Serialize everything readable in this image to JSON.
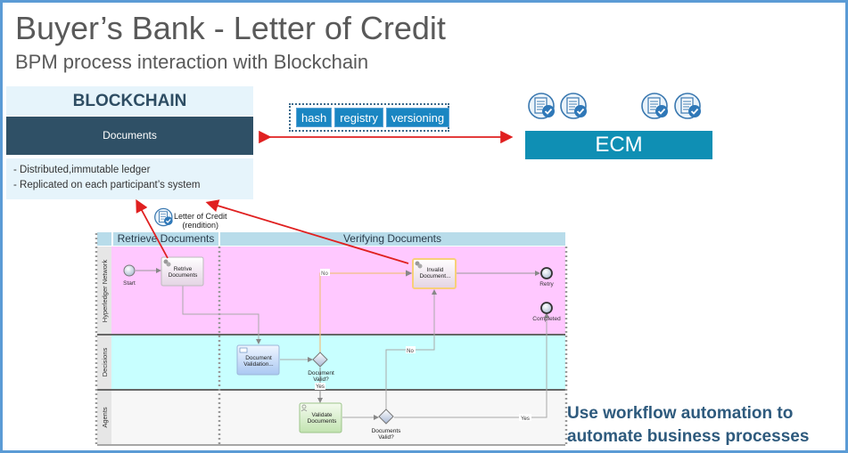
{
  "header": {
    "title": "Buyer’s Bank - Letter of Credit",
    "subtitle": "BPM process interaction with Blockchain"
  },
  "blockchain": {
    "heading": "BLOCKCHAIN",
    "documents_label": "Documents",
    "notes": [
      "- Distributed,immutable ledger",
      "- Replicated on each participant’s system"
    ]
  },
  "services": {
    "tags": [
      "hash",
      "registry",
      "versioning"
    ]
  },
  "ecm": {
    "label": "ECM",
    "document_icons": [
      "document-check-icon",
      "document-check-icon",
      "document-check-icon",
      "document-check-icon"
    ]
  },
  "letter_of_credit": {
    "label_line1": "Letter of Credit",
    "label_line2": "(rendition)",
    "icon": "document-check-icon"
  },
  "process": {
    "phases": [
      "Retrieve Documents",
      "Verifying Documents"
    ],
    "lanes": [
      "Hyperledger Network",
      "Decisions",
      "Agents"
    ],
    "events": {
      "start": "Start",
      "retry": "Retry",
      "completed": "Completed"
    },
    "tasks": {
      "retrieve": [
        "Retrive",
        "Documents"
      ],
      "invalid": [
        "Invalid",
        "Document..."
      ],
      "validation": [
        "Document",
        "Validation..."
      ],
      "validate": [
        "Validate",
        "Documents"
      ]
    },
    "gateways": {
      "document_valid": [
        "Document",
        "Valid?"
      ],
      "documents_valid": [
        "Documents",
        "Valid?"
      ]
    },
    "flow_labels": {
      "no_top": "No",
      "yes_decision": "Yes",
      "no_agents": "No",
      "yes_agents": "Yes"
    }
  },
  "colors": {
    "frame": "#5b9bd5",
    "blockchain_dark": "#2f5066",
    "blockchain_light": "#e6f4fb",
    "tag_blue": "#1a86c2",
    "ecm_teal": "#0f8fb4",
    "arrow_red": "#e02020",
    "lane_network": "#ffc8ff",
    "lane_decisions": "#c8ffff",
    "lane_agents": "#f7f7f7",
    "phase_header": "#b8dcea",
    "callout": "#2e5a7d"
  },
  "callout": {
    "line1": "Use workflow automation to",
    "line2": "automate business processes"
  }
}
